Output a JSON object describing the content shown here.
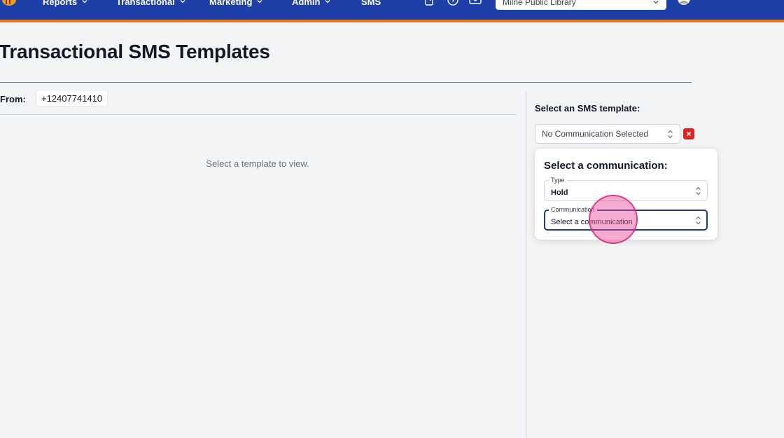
{
  "nav": {
    "items": [
      {
        "label": "Reports",
        "has_dropdown": true
      },
      {
        "label": "Transactional",
        "has_dropdown": true
      },
      {
        "label": "Marketing",
        "has_dropdown": true
      },
      {
        "label": "Admin",
        "has_dropdown": true
      },
      {
        "label": "SMS",
        "has_dropdown": false
      }
    ],
    "icons": [
      "external-link-icon",
      "help-icon",
      "mail-icon"
    ],
    "library_select": "Milne Public Library",
    "accent_color": "#e07b24",
    "bar_color": "#1f3fa8"
  },
  "page": {
    "title": "Transactional SMS Templates",
    "from_label": "From:",
    "from_value": "+12407741410",
    "empty_message": "Select a template to view."
  },
  "template_panel": {
    "label": "Select an SMS template:",
    "selected": "No Communication Selected",
    "clear_label": "×",
    "popover": {
      "title": "Select a communication:",
      "type_field": {
        "label": "Type",
        "value": "Hold"
      },
      "communication_field": {
        "label": "Communication",
        "value": "Select a communication"
      }
    }
  }
}
